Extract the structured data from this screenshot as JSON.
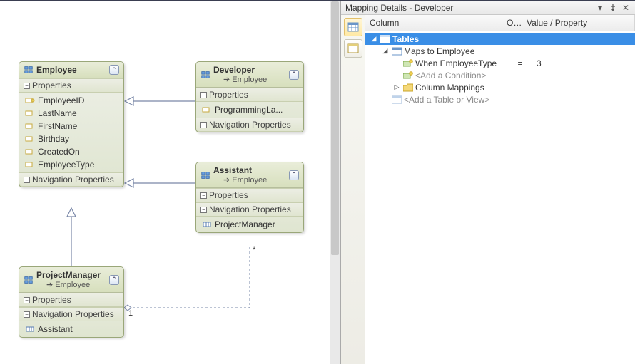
{
  "panel": {
    "title": "Mapping Details - Developer",
    "columns": {
      "a": "Column",
      "b": "O..",
      "c": "Value / Property"
    },
    "tree": {
      "tables_label": "Tables",
      "maps_to": "Maps to Employee",
      "condition": {
        "label": "When EmployeeType",
        "operator": "=",
        "value": "3"
      },
      "add_condition": "<Add a Condition>",
      "column_mappings": "Column Mappings",
      "add_table": "<Add a Table or View>"
    }
  },
  "labels": {
    "properties": "Properties",
    "nav_properties": "Navigation Properties",
    "arrow": "➔"
  },
  "entities": {
    "employee": {
      "name": "Employee",
      "props": [
        "EmployeeID",
        "LastName",
        "FirstName",
        "Birthday",
        "CreatedOn",
        "EmployeeType"
      ]
    },
    "developer": {
      "name": "Developer",
      "base": "Employee",
      "props": [
        "ProgrammingLa..."
      ]
    },
    "assistant_ent": {
      "name": "Assistant",
      "base": "Employee",
      "nav": [
        "ProjectManager"
      ]
    },
    "projectmanager": {
      "name": "ProjectManager",
      "base": "Employee",
      "nav": [
        "Assistant"
      ]
    }
  },
  "assoc": {
    "pm_mult": "1",
    "asst_mult": "*"
  }
}
